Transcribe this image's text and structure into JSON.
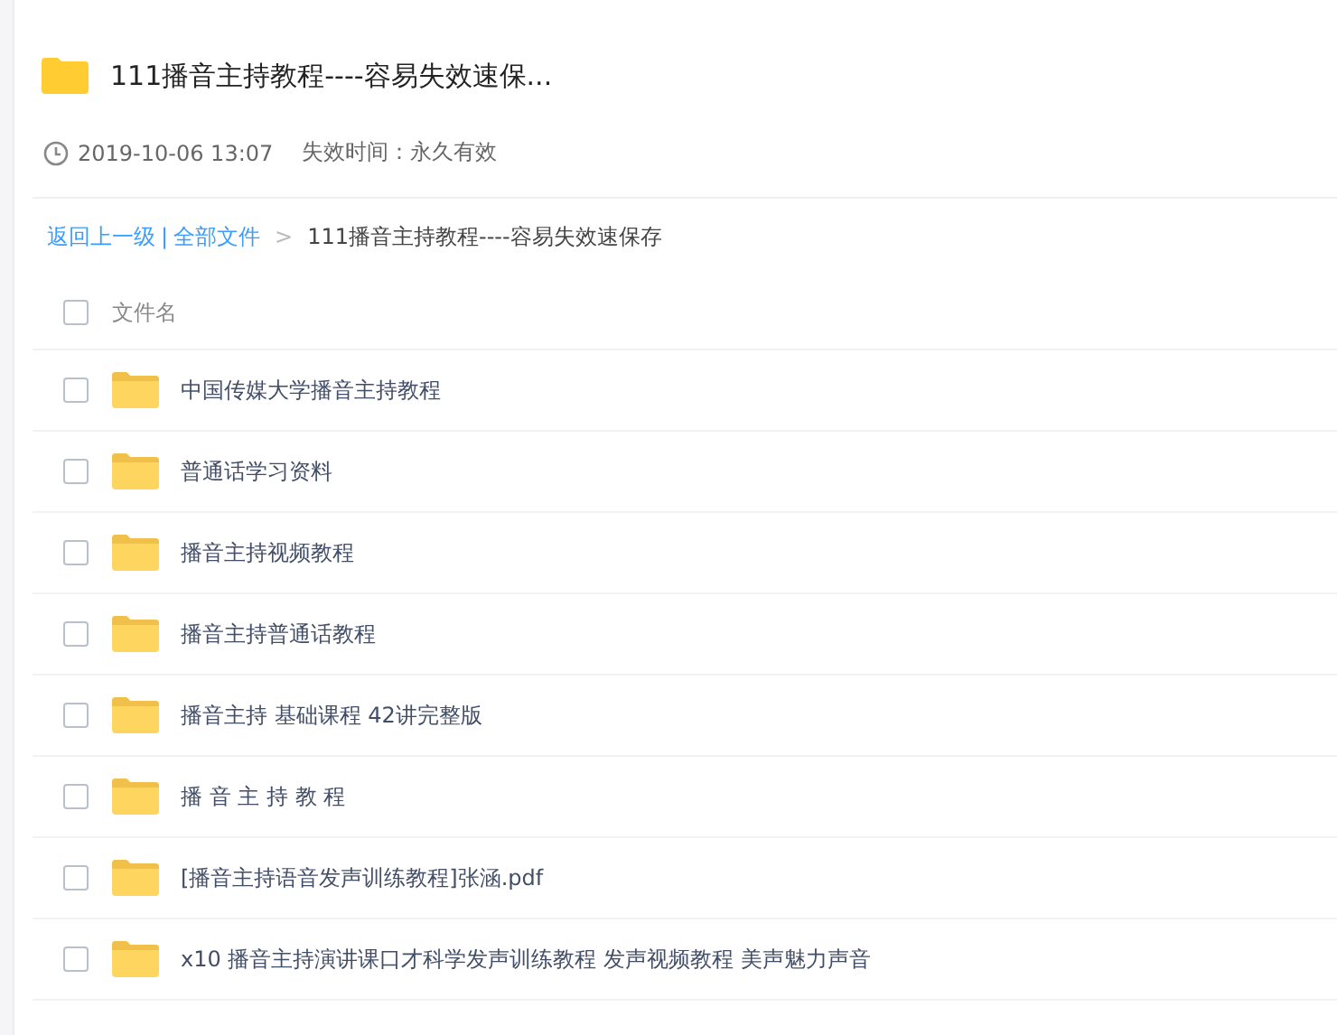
{
  "share": {
    "title": "111播音主持教程----容易失效速保...",
    "date": "2019-10-06 13:07",
    "expiry": "失效时间：永久有效"
  },
  "breadcrumb": {
    "back": "返回上一级",
    "separator": "|",
    "root": "全部文件",
    "arrow": ">",
    "current": "111播音主持教程----容易失效速保存"
  },
  "table": {
    "header": {
      "label": "文件名",
      "checked": false
    },
    "rows": [
      {
        "name": "中国传媒大学播音主持教程",
        "checked": false
      },
      {
        "name": "普通话学习资料",
        "checked": false
      },
      {
        "name": "播音主持视频教程",
        "checked": false
      },
      {
        "name": "播音主持普通话教程",
        "checked": false
      },
      {
        "name": "播音主持 基础课程 42讲完整版",
        "checked": false
      },
      {
        "name": "播 音 主 持 教 程",
        "checked": false
      },
      {
        "name": "[播音主持语音发声训练教程]张涵.pdf",
        "checked": false
      },
      {
        "name": "x10 播音主持演讲课口才科学发声训练教程 发声视频教程 美声魅力声音",
        "checked": false
      }
    ]
  }
}
